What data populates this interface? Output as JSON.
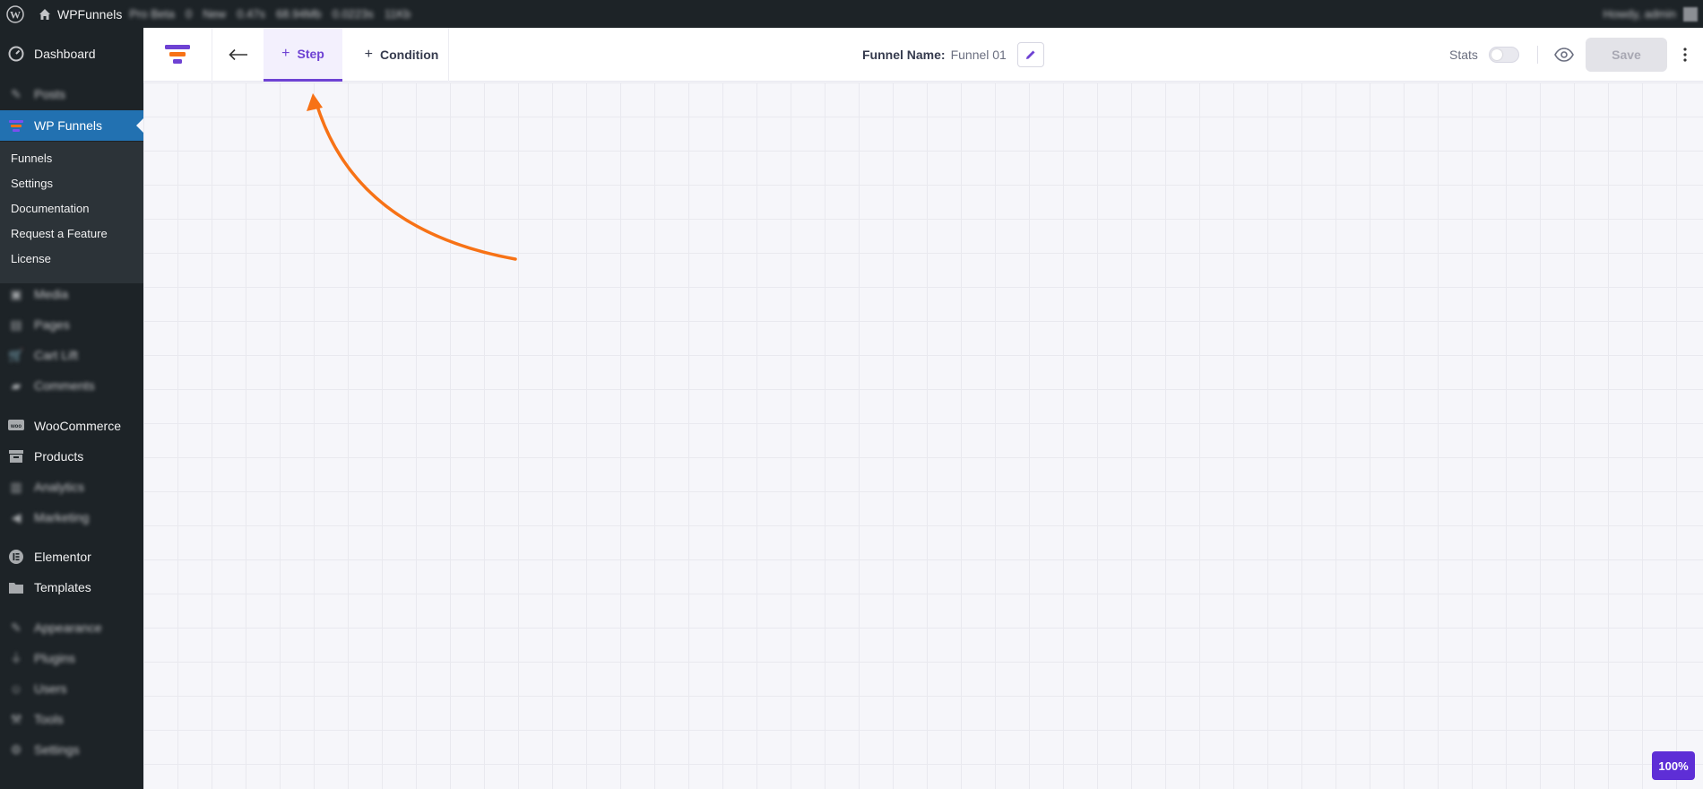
{
  "admin_bar": {
    "site_name": "WPFunnels",
    "blurred_items": [
      "Pro Beta",
      "0",
      "New",
      "0.47s",
      "68.94Mb",
      "0.0223s",
      "11Kb"
    ],
    "greeting": "Howdy, admin"
  },
  "sidebar": {
    "dashboard": "Dashboard",
    "posts": "Posts",
    "wp_funnels": "WP Funnels",
    "submenu": [
      "Funnels",
      "Settings",
      "Documentation",
      "Request a Feature",
      "License"
    ],
    "media": "Media",
    "pages": "Pages",
    "cart_lift": "Cart Lift",
    "comments": "Comments",
    "woocommerce": "WooCommerce",
    "products": "Products",
    "analytics": "Analytics",
    "marketing": "Marketing",
    "elementor": "Elementor",
    "templates": "Templates",
    "appearance": "Appearance",
    "plugins": "Plugins",
    "users": "Users",
    "tools": "Tools",
    "settings": "Settings"
  },
  "header": {
    "tab_step": "Step",
    "tab_condition": "Condition",
    "funnel_name_label": "Funnel Name:",
    "funnel_name_value": "Funnel 01",
    "stats_label": "Stats",
    "stats_enabled": false,
    "save_label": "Save"
  },
  "canvas": {
    "zoom": "100%"
  },
  "colors": {
    "accent": "#6e42d3",
    "annotation_arrow": "#f77216",
    "wp_active": "#2271b1"
  }
}
